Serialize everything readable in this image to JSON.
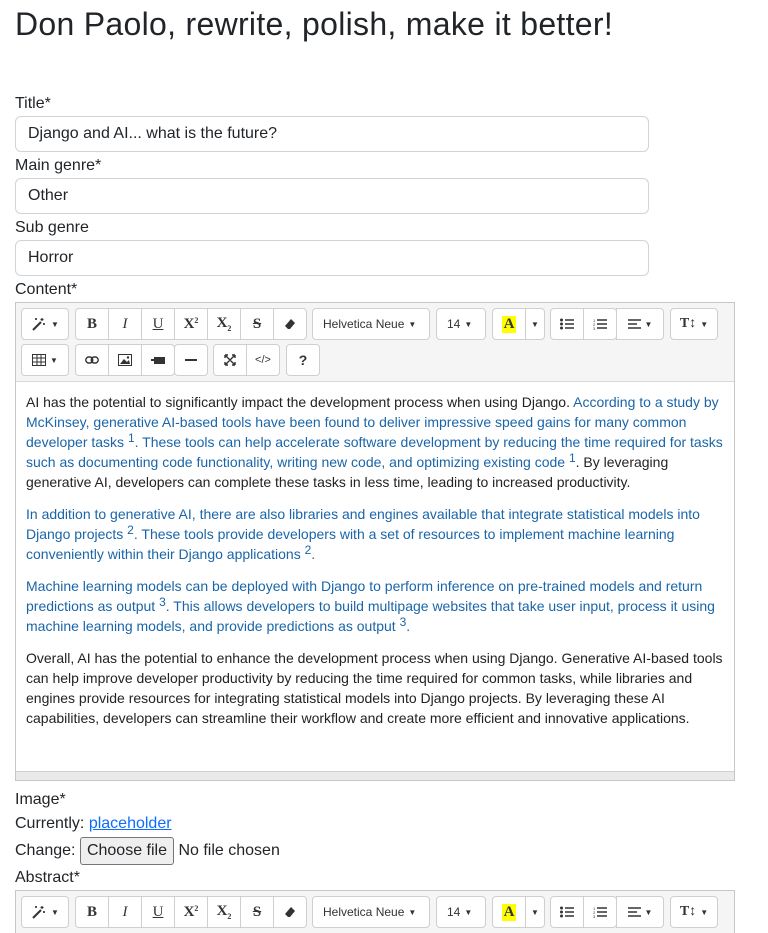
{
  "heading": "Don Paolo, rewrite, polish, make it better!",
  "fields": {
    "title": {
      "label": "Title*",
      "value": "Django and AI... what is the future?"
    },
    "main_genre": {
      "label": "Main genre*",
      "value": "Other"
    },
    "sub_genre": {
      "label": "Sub genre",
      "value": "Horror"
    },
    "content": {
      "label": "Content*"
    },
    "image": {
      "label": "Image*",
      "currently_label": "Currently:",
      "current_link": "placeholder",
      "change_label": "Change:",
      "choose_button": "Choose file",
      "no_file": "No file chosen"
    },
    "abstract": {
      "label": "Abstract*"
    }
  },
  "toolbar": {
    "font_name": "Helvetica Neue",
    "font_size": "14",
    "icons": [
      "magic-icon",
      "bold-icon",
      "italic-icon",
      "underline-icon",
      "superscript-icon",
      "subscript-icon",
      "strikethrough-icon",
      "eraser-icon",
      "font-family-dropdown",
      "font-size-dropdown",
      "highlight-icon",
      "unordered-list-icon",
      "ordered-list-icon",
      "align-icon",
      "text-height-icon",
      "table-icon",
      "link-icon",
      "picture-icon",
      "video-icon",
      "horizontal-rule-icon",
      "fullscreen-icon",
      "code-view-icon",
      "help-icon"
    ],
    "help_label": "?"
  },
  "content": {
    "p1a": "AI has the potential to significantly impact the development process when using Django. ",
    "p1b": "According to a study by McKinsey, generative AI-based tools have been found to deliver impressive speed gains for many common developer tasks ",
    "p1b_ref": "1",
    "p1c": ". These tools can help accelerate software development by reducing the time required for tasks such as documenting code functionality, writing new code, and optimizing existing code ",
    "p1c_ref": "1",
    "p1d": ". By leveraging generative AI, developers can complete these tasks in less time, leading to increased productivity.",
    "p2a": "In addition to generative AI, there are also libraries and engines available that integrate statistical models into Django projects ",
    "p2a_ref": "2",
    "p2b": ". These tools provide developers with a set of resources to implement machine learning conveniently within their Django applications ",
    "p2b_ref": "2",
    "p2c": ".",
    "p3a": "Machine learning models can be deployed with Django to perform inference on pre-trained models and return predictions as output ",
    "p3a_ref": "3",
    "p3b": ". This allows developers to build multipage websites that take user input, process it using machine learning models, and provide predictions as output ",
    "p3b_ref": "3",
    "p3c": ".",
    "p4": "Overall, AI has the potential to enhance the development process when using Django. Generative AI-based tools can help improve developer productivity by reducing the time required for common tasks, while libraries and engines provide resources for integrating statistical models into Django projects. By leveraging these AI capabilities, developers can streamline their workflow and create more efficient and innovative applications."
  },
  "colors": {
    "link_text": "#1a65a9",
    "highlight": "#ffff00",
    "accent_link": "#0d6efd"
  }
}
